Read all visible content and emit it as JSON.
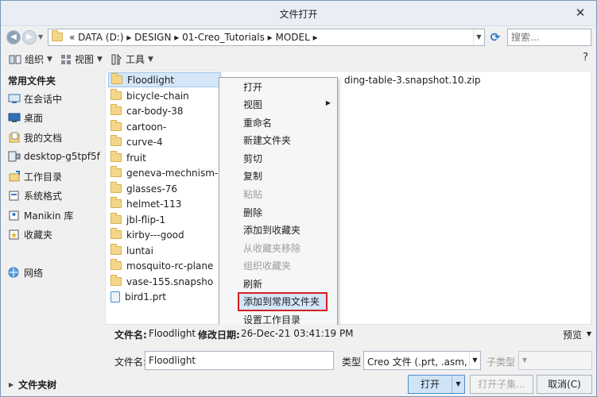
{
  "window": {
    "title": "文件打开",
    "close_glyph": "✕"
  },
  "address": {
    "crumbs": "«  DATA (D:)  ▸  DESIGN  ▸  01-Creo_Tutorials  ▸  MODEL  ▸",
    "search_placeholder": "搜索..."
  },
  "toolbar": {
    "organize": "组织",
    "view": "视图",
    "tools": "工具",
    "help_glyph": "?"
  },
  "sidebar": {
    "heading": "常用文件夹",
    "items": [
      {
        "label": "在会话中",
        "icon": "session-icon"
      },
      {
        "label": "桌面",
        "icon": "desktop-icon"
      },
      {
        "label": "我的文档",
        "icon": "documents-icon"
      },
      {
        "label": "desktop-g5tpf5f",
        "icon": "computer-icon"
      },
      {
        "label": "工作目录",
        "icon": "working-directory-icon"
      },
      {
        "label": "系统格式",
        "icon": "system-formats-icon"
      },
      {
        "label": "Manikin 库",
        "icon": "manikin-library-icon"
      },
      {
        "label": "收藏夹",
        "icon": "favorites-icon"
      },
      {
        "label": "网络",
        "icon": "network-icon"
      }
    ]
  },
  "files": [
    {
      "name": "Floodlight",
      "type": "folder",
      "selected": true
    },
    {
      "name": "bicycle-chain",
      "type": "folder"
    },
    {
      "name": "car-body-38",
      "type": "folder"
    },
    {
      "name": "cartoon-",
      "type": "folder"
    },
    {
      "name": "curve-4",
      "type": "folder"
    },
    {
      "name": "fruit",
      "type": "folder"
    },
    {
      "name": "geneva-mechnism-2-",
      "type": "folder"
    },
    {
      "name": "glasses-76",
      "type": "folder"
    },
    {
      "name": "helmet-113",
      "type": "folder"
    },
    {
      "name": "jbl-flip-1",
      "type": "folder"
    },
    {
      "name": "kirby---good",
      "type": "folder"
    },
    {
      "name": "luntai",
      "type": "folder"
    },
    {
      "name": "mosquito-rc-plane",
      "type": "folder"
    },
    {
      "name": "vase-155.snapsho",
      "type": "folder"
    },
    {
      "name": "bird1.prt",
      "type": "part"
    }
  ],
  "right_file": {
    "name": "ding-table-3.snapshot.10.zip"
  },
  "context_menu": [
    {
      "label": "打开",
      "enabled": true
    },
    {
      "label": "视图",
      "enabled": true,
      "submenu": true
    },
    {
      "label": "重命名",
      "enabled": true
    },
    {
      "label": "新建文件夹",
      "enabled": true
    },
    {
      "label": "剪切",
      "enabled": true
    },
    {
      "label": "复制",
      "enabled": true
    },
    {
      "label": "粘贴",
      "enabled": false
    },
    {
      "label": "删除",
      "enabled": true
    },
    {
      "label": "添加到收藏夹",
      "enabled": true
    },
    {
      "label": "从收藏夹移除",
      "enabled": false
    },
    {
      "label": "组织收藏夹",
      "enabled": false
    },
    {
      "label": "刷新",
      "enabled": true
    },
    {
      "label": "添加到常用文件夹",
      "enabled": true,
      "highlighted": true
    },
    {
      "label": "设置工作目录",
      "enabled": true
    }
  ],
  "info": {
    "filename_label": "文件名:",
    "filename_value": "Floodlight",
    "modified_label": "修改日期:",
    "modified_value": "26-Dec-21 03:41:19 PM",
    "preview": "预览"
  },
  "form": {
    "filename_label": "文件名:",
    "filename_value": "Floodlight",
    "type_label": "类型",
    "type_value": "Creo 文件 (.prt, .asm,",
    "subtype_label": "子类型"
  },
  "bottom": {
    "folder_tree": "文件夹树",
    "open": "打开",
    "open_subset": "打开子集...",
    "cancel": "取消(C)"
  },
  "colors": {
    "highlight_border": "#d32020",
    "selection": "#d5e6f8",
    "accent": "#2f78c8"
  }
}
